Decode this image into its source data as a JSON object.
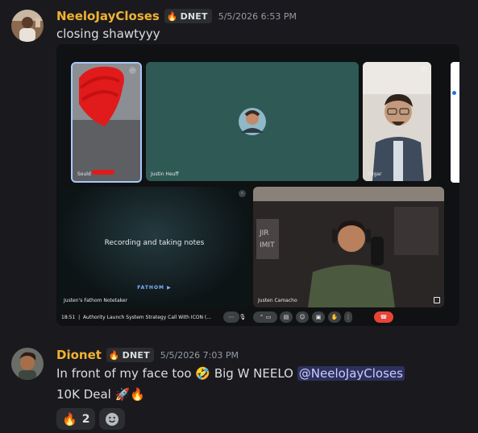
{
  "messages": [
    {
      "username": "NeeloJayCloses",
      "tag": "DNET",
      "tag_icon": "🔥",
      "timestamp": "5/5/2026 6:53 PM",
      "text": "closing shawtyyy",
      "attachment": {
        "tiles": [
          {
            "label": "Sould"
          },
          {
            "label": "Justin Heuff"
          },
          {
            "label": "Edgar"
          },
          {
            "label": "Justen's Fathom Notetaker",
            "center_text": "Recording and taking notes",
            "brand": "FATHOM ▶"
          },
          {
            "label": "Justen Camacho"
          }
        ],
        "control_bar": {
          "time": "18:51",
          "meeting_title": "Authority Launch System Strategy Call With ICON (..."
        }
      }
    },
    {
      "username": "Dionet",
      "tag": "DNET",
      "tag_icon": "🔥",
      "timestamp": "5/5/2026 7:03 PM",
      "text_part1": "In front of my face too",
      "emoji1": "🤣",
      "text_part2": " Big W NEELO ",
      "mention": "@NeeloJayCloses",
      "line2_text": "10K Deal",
      "line2_emojis": "🚀🔥",
      "reactions": [
        {
          "emoji": "🔥",
          "count": "2"
        }
      ]
    }
  ],
  "colors": {
    "background": "#1a1a1e",
    "username": "#f0b232",
    "mention_bg": "#3c4275"
  }
}
